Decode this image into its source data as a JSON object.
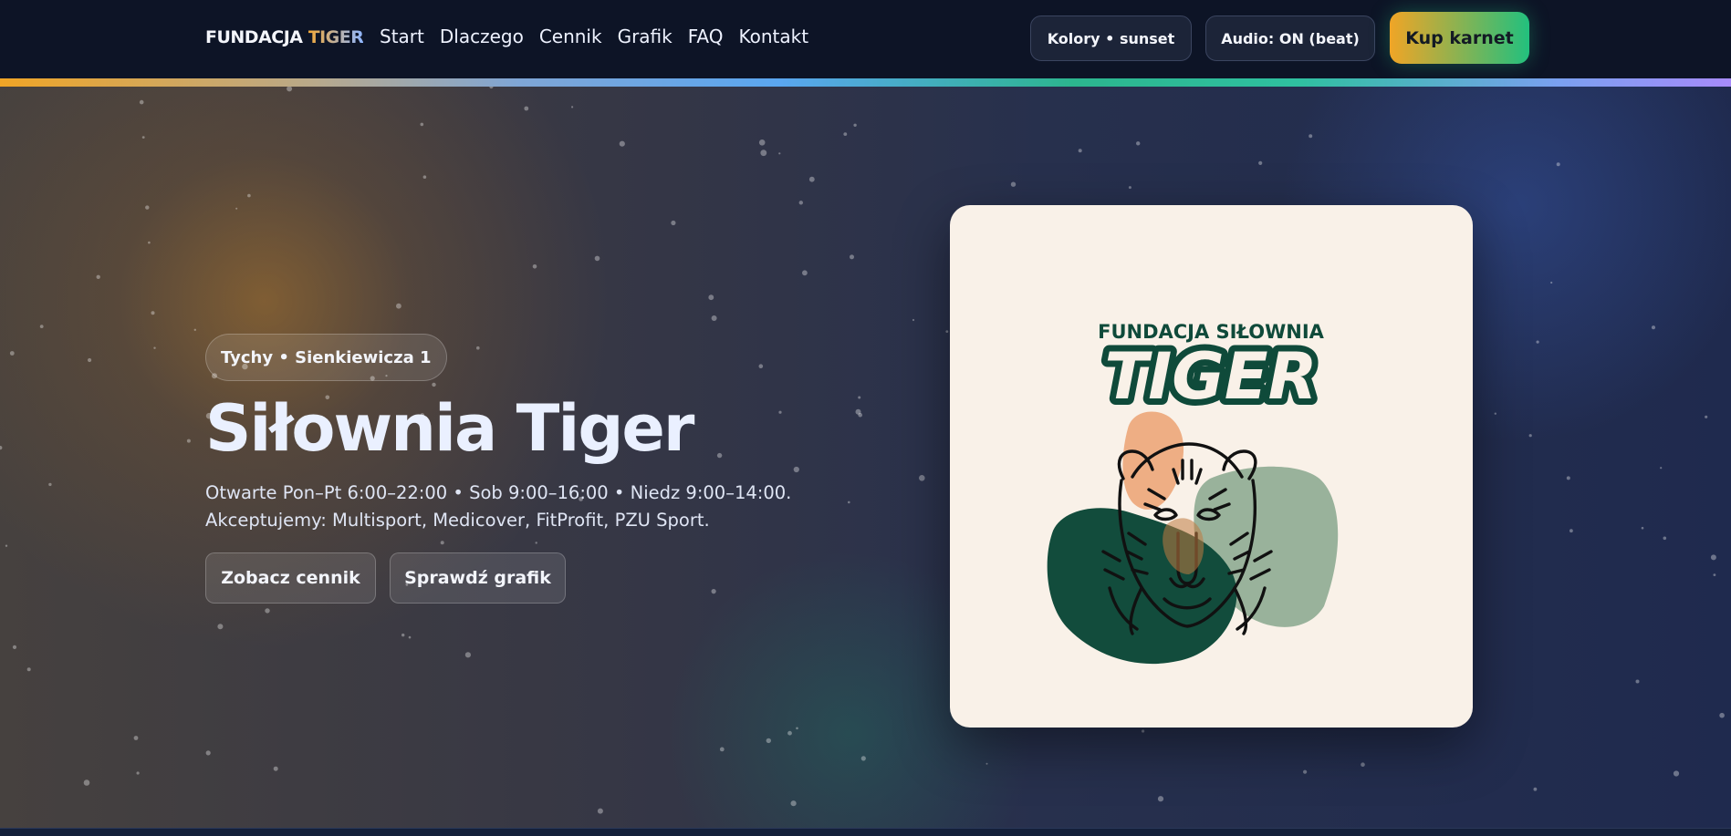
{
  "header": {
    "brand_main": "FUNDACJA",
    "brand_accent": "TIGER",
    "nav": [
      "Start",
      "Dlaczego",
      "Cennik",
      "Grafik",
      "FAQ",
      "Kontakt"
    ],
    "colors_button": "Kolory • sunset",
    "audio_button": "Audio: ON (beat)",
    "cta_button": "Kup karnet"
  },
  "hero": {
    "location_badge": "Tychy • Sienkiewicza 1",
    "title": "Siłownia Tiger",
    "description": "Otwarte Pon–Pt 6:00–22:00 • Sob 9:00–16:00 • Niedz 9:00–14:00. Akceptujemy: Multisport, Medicover, FitProfit, PZU Sport.",
    "buttons": {
      "pricing": "Zobacz cennik",
      "schedule": "Sprawdź grafik"
    }
  },
  "logo": {
    "line1": "FUNDACJA SIŁOWNIA",
    "line2": "TIGER",
    "icon": "tiger-head-icon"
  },
  "colors": {
    "header_bg": "#0d1426",
    "cta_start": "#f0a526",
    "cta_end": "#22c07e",
    "card_bg": "#f9f1e8",
    "logo_green": "#0f4a3a"
  }
}
